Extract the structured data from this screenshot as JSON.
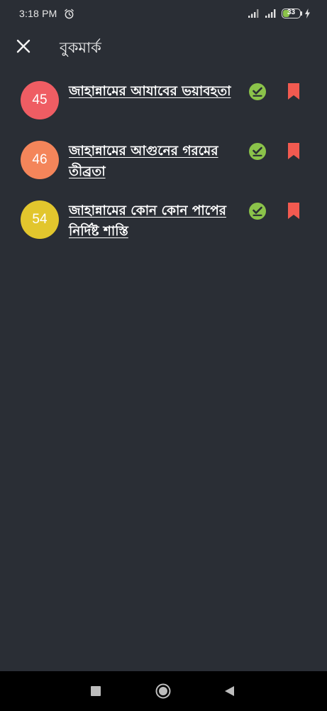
{
  "status_bar": {
    "time": "3:18 PM",
    "battery_level": "33",
    "icons": [
      "alarm-icon",
      "signal-icon",
      "signal-icon",
      "battery-icon",
      "charging-icon"
    ]
  },
  "header": {
    "title": "বুকমার্ক",
    "close_icon": "close-icon"
  },
  "bookmarks": [
    {
      "number": "45",
      "title": "জাহান্নামের আযাবের ভয়াবহতা",
      "badge_color": "#ef5d63"
    },
    {
      "number": "46",
      "title": "জাহান্নামের আগুনের গরমের তীব্রতা",
      "badge_color": "#f4855a"
    },
    {
      "number": "54",
      "title": "জাহান্নামের কোন কোন পাপের নির্দিষ্ট শাস্তি",
      "badge_color": "#e2c62d"
    }
  ],
  "colors": {
    "background": "#2a2e35",
    "read_check": "#8bc34a",
    "bookmark": "#f25a50",
    "nav_bar": "#000000"
  },
  "nav_bar": {
    "icons": [
      "recents-square-icon",
      "home-circle-icon",
      "back-triangle-icon"
    ]
  }
}
